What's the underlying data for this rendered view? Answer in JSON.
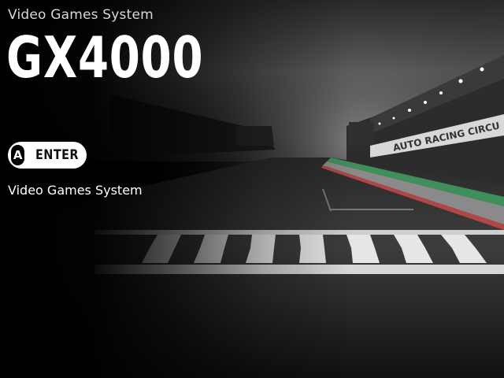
{
  "header": {
    "subtitle": "Video Games System",
    "title": "GX4000"
  },
  "actions": {
    "enter": {
      "button_glyph": "A",
      "label": "ENTER"
    }
  },
  "main": {
    "description": "Video Games System"
  },
  "background": {
    "scene": "race-track-image",
    "billboard_text": "AUTO RACING CIRCU"
  },
  "colors": {
    "background": "#000000",
    "text": "#ffffff",
    "button": "#ffffff",
    "button_text": "#111111",
    "track_green": "#3f8f5b",
    "track_red": "#b04646"
  }
}
